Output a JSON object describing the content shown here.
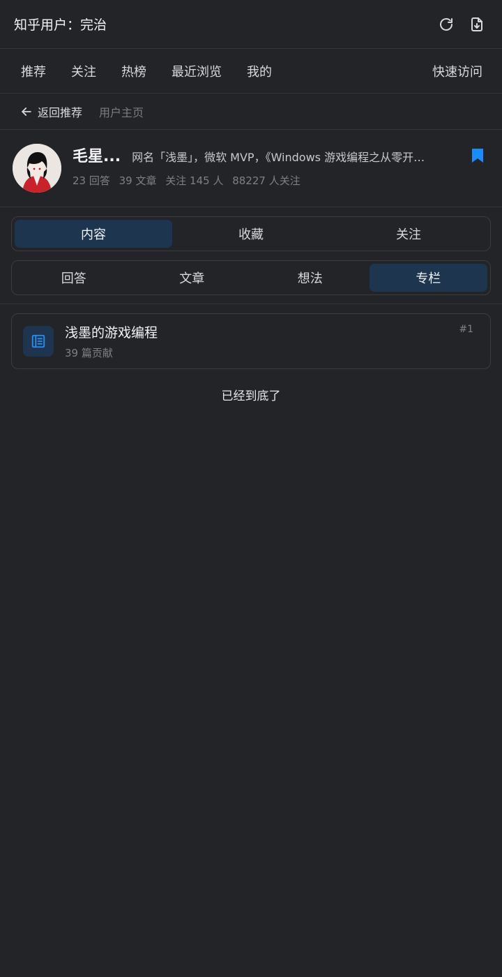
{
  "header": {
    "title": "知乎用户：完治",
    "refresh_icon": "refresh-icon",
    "export_icon": "file-download-icon"
  },
  "nav": {
    "items": [
      "推荐",
      "关注",
      "热榜",
      "最近浏览",
      "我的"
    ],
    "quick_access": "快速访问"
  },
  "breadcrumb": {
    "back_label": "返回推荐",
    "current": "用户主页"
  },
  "profile": {
    "name": "毛星...",
    "bio": "网名「浅墨」，微软 MVP，《Windows 游戏编程之从零开…",
    "stats": {
      "answers": "23 回答",
      "articles": "39 文章",
      "following": "关注 145 人",
      "followers": "88227 人关注"
    },
    "bookmark_color": "#1a8cff"
  },
  "tabs_primary": {
    "items": [
      "内容",
      "收藏",
      "关注"
    ],
    "active": "内容"
  },
  "tabs_secondary": {
    "items": [
      "回答",
      "文章",
      "想法",
      "专栏"
    ],
    "active": "专栏"
  },
  "columns": [
    {
      "title": "浅墨的游戏编程",
      "subtitle": "39 篇贡献",
      "rank": "#1",
      "icon": "column-book-icon"
    }
  ],
  "footer": {
    "end_text": "已经到底了"
  },
  "colors": {
    "background": "#232428",
    "accent": "#1a8cff",
    "active_tab": "#1e3550"
  }
}
